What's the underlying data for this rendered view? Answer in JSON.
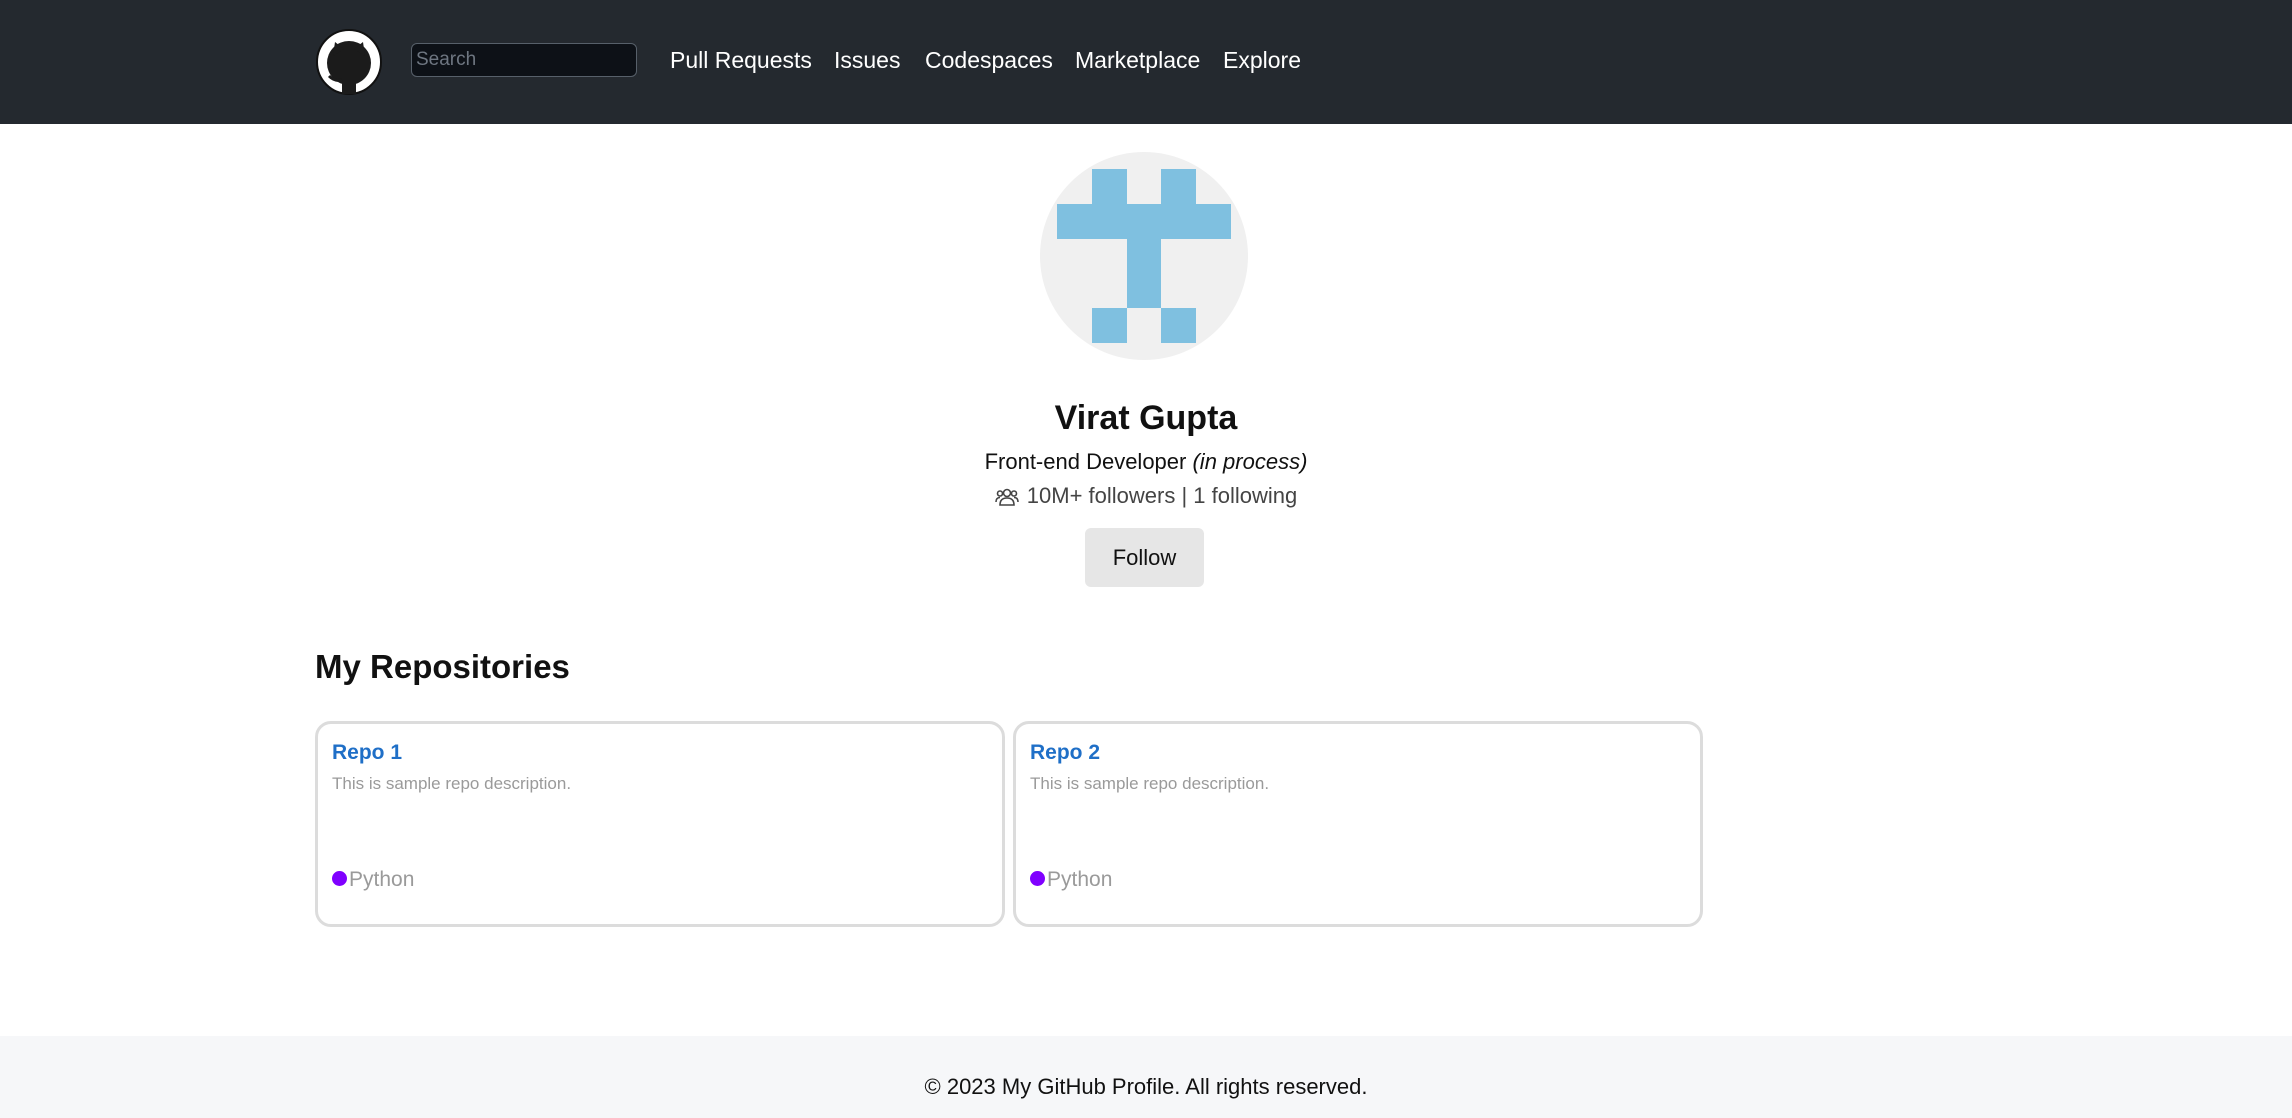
{
  "header": {
    "search_placeholder": "Search",
    "nav": [
      "Pull Requests",
      "Issues",
      "Codespaces",
      "Marketplace",
      "Explore"
    ]
  },
  "profile": {
    "name": "Virat Gupta",
    "role": "Front-end Developer",
    "role_note": "(in process)",
    "stats": "10M+ followers | 1 following",
    "follow_label": "Follow"
  },
  "repositories": {
    "heading": "My Repositories",
    "items": [
      {
        "name": "Repo 1",
        "description": "This is sample repo description.",
        "language": "Python"
      },
      {
        "name": "Repo 2",
        "description": "This is sample repo description.",
        "language": "Python"
      }
    ]
  },
  "footer": {
    "text": "© 2023 My GitHub Profile. All rights reserved."
  },
  "colors": {
    "header_bg": "#24292f",
    "link": "#1f6fc7",
    "python": "#8000ff",
    "avatar_pattern": "#7fc0e0"
  },
  "icons": {
    "logo": "github-octocat-icon",
    "stats": "people-icon",
    "language": "language-dot-icon"
  }
}
